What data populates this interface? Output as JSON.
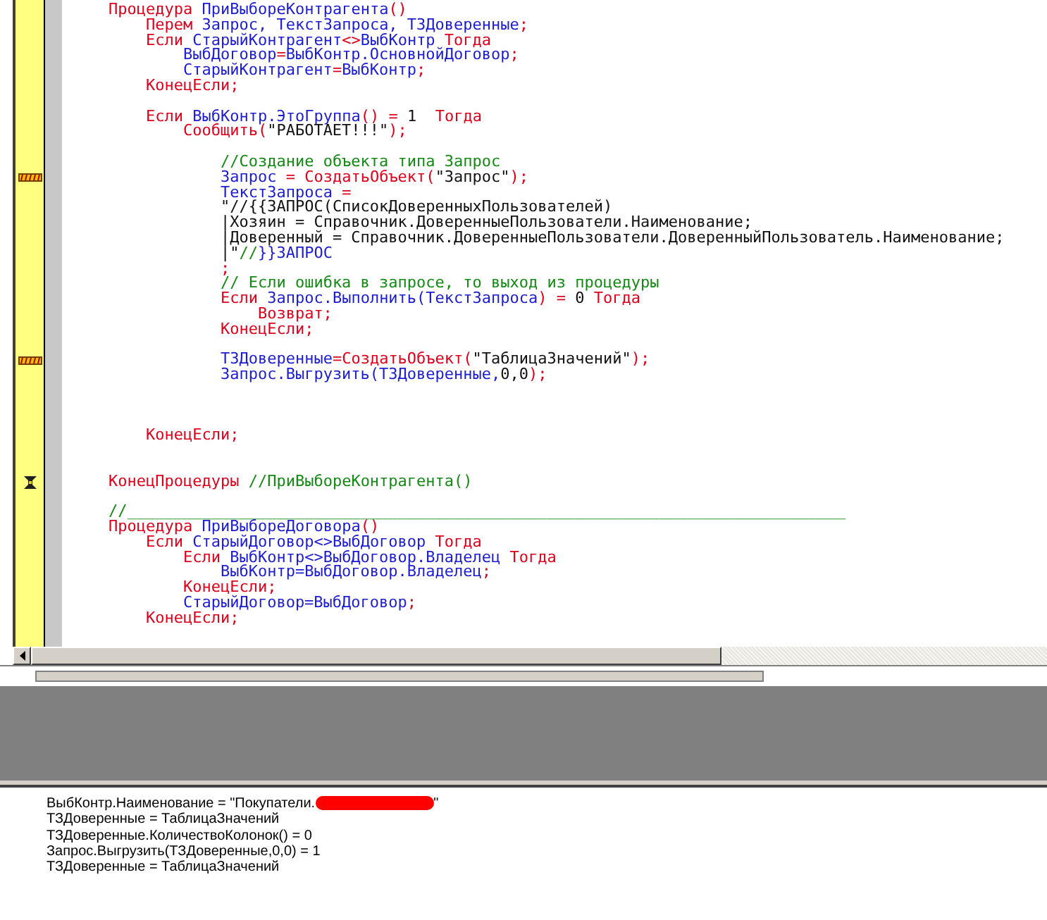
{
  "editor": {
    "lines": [
      {
        "kind": "code",
        "bookmarked": false,
        "current": false,
        "tokens": [
          {
            "kind": "kw",
            "text": "Процедура "
          },
          {
            "kind": "id",
            "text": "ПриВыбореКонтрагента"
          },
          {
            "kind": "kw",
            "text": "()"
          }
        ]
      },
      {
        "kind": "code",
        "bookmarked": false,
        "current": false,
        "tokens": [
          {
            "kind": "kw",
            "text": "    Перем "
          },
          {
            "kind": "id",
            "text": "Запрос, ТекстЗапроса, ТЗДоверенные"
          },
          {
            "kind": "kw",
            "text": ";"
          }
        ]
      },
      {
        "kind": "code",
        "bookmarked": false,
        "current": false,
        "tokens": [
          {
            "kind": "kw",
            "text": "    Если "
          },
          {
            "kind": "id",
            "text": "СтарыйКонтрагент"
          },
          {
            "kind": "kw",
            "text": "<>"
          },
          {
            "kind": "id",
            "text": "ВыбКонтр"
          },
          {
            "kind": "kw",
            "text": " Тогда"
          }
        ]
      },
      {
        "kind": "code",
        "bookmarked": false,
        "current": false,
        "tokens": [
          {
            "kind": "id",
            "text": "        ВыбДоговор"
          },
          {
            "kind": "kw",
            "text": "="
          },
          {
            "kind": "id",
            "text": "ВыбКонтр.ОсновнойДоговор"
          },
          {
            "kind": "kw",
            "text": ";"
          }
        ]
      },
      {
        "kind": "code",
        "bookmarked": false,
        "current": false,
        "tokens": [
          {
            "kind": "id",
            "text": "        СтарыйКонтрагент"
          },
          {
            "kind": "kw",
            "text": "="
          },
          {
            "kind": "id",
            "text": "ВыбКонтр"
          },
          {
            "kind": "kw",
            "text": ";"
          }
        ]
      },
      {
        "kind": "code",
        "bookmarked": false,
        "current": false,
        "tokens": [
          {
            "kind": "kw",
            "text": "    КонецЕсли;"
          }
        ]
      },
      {
        "kind": "blank",
        "bookmarked": false,
        "current": false
      },
      {
        "kind": "code",
        "bookmarked": false,
        "current": false,
        "tokens": [
          {
            "kind": "kw",
            "text": "    Если "
          },
          {
            "kind": "id",
            "text": "ВыбКонтр.ЭтоГруппа"
          },
          {
            "kind": "kw",
            "text": "() = "
          },
          {
            "kind": "tx",
            "text": "1"
          },
          {
            "kind": "kw",
            "text": "  Тогда"
          }
        ]
      },
      {
        "kind": "code",
        "bookmarked": false,
        "current": false,
        "tokens": [
          {
            "kind": "kw",
            "text": "        Сообщить("
          },
          {
            "kind": "tx",
            "text": "\"РАБОТАЕТ!!!\""
          },
          {
            "kind": "kw",
            "text": ");"
          }
        ]
      },
      {
        "kind": "blank",
        "bookmarked": false,
        "current": false
      },
      {
        "kind": "code",
        "bookmarked": false,
        "current": false,
        "tokens": [
          {
            "kind": "cm",
            "text": "            //Создание объекта типа Запрос"
          }
        ]
      },
      {
        "kind": "code",
        "bookmarked": true,
        "current": false,
        "tokens": [
          {
            "kind": "id",
            "text": "            Запрос"
          },
          {
            "kind": "kw",
            "text": " = СоздатьОбъект("
          },
          {
            "kind": "tx",
            "text": "\"Запрос\""
          },
          {
            "kind": "kw",
            "text": ");"
          }
        ]
      },
      {
        "kind": "code",
        "bookmarked": false,
        "current": false,
        "tokens": [
          {
            "kind": "id",
            "text": "            ТекстЗапроса"
          },
          {
            "kind": "kw",
            "text": " ="
          }
        ]
      },
      {
        "kind": "code",
        "bookmarked": false,
        "current": false,
        "tokens": [
          {
            "kind": "tx",
            "text": "            \"//{{ЗАПРОС(СписокДоверенныхПользователей)"
          }
        ]
      },
      {
        "kind": "code",
        "bookmarked": false,
        "current": false,
        "tokens": [
          {
            "kind": "tx",
            "text": "            |Хозяин = Справочник.ДоверенныеПользователи.Наименование;"
          }
        ]
      },
      {
        "kind": "code",
        "bookmarked": false,
        "current": false,
        "tokens": [
          {
            "kind": "tx",
            "text": "            |Доверенный = Справочник.ДоверенныеПользователи.ДоверенныйПользователь.Наименование;"
          }
        ]
      },
      {
        "kind": "code",
        "bookmarked": false,
        "current": false,
        "tokens": [
          {
            "kind": "tx",
            "text": "            |\""
          },
          {
            "kind": "cm",
            "text": "//"
          },
          {
            "kind": "id",
            "text": "}}ЗАПРОС"
          }
        ]
      },
      {
        "kind": "code",
        "bookmarked": false,
        "current": false,
        "tokens": [
          {
            "kind": "kw",
            "text": "            ;"
          }
        ]
      },
      {
        "kind": "code",
        "bookmarked": false,
        "current": false,
        "tokens": [
          {
            "kind": "cm",
            "text": "            // Если ошибка в запросе, то выход из процедуры"
          }
        ]
      },
      {
        "kind": "code",
        "bookmarked": false,
        "current": false,
        "tokens": [
          {
            "kind": "kw",
            "text": "            Если "
          },
          {
            "kind": "id",
            "text": "Запрос.Выполнить(ТекстЗапроса"
          },
          {
            "kind": "kw",
            "text": ") = "
          },
          {
            "kind": "tx",
            "text": "0"
          },
          {
            "kind": "kw",
            "text": " Тогда"
          }
        ]
      },
      {
        "kind": "code",
        "bookmarked": false,
        "current": false,
        "tokens": [
          {
            "kind": "kw",
            "text": "                Возврат;"
          }
        ]
      },
      {
        "kind": "code",
        "bookmarked": false,
        "current": false,
        "tokens": [
          {
            "kind": "kw",
            "text": "            КонецЕсли;"
          }
        ]
      },
      {
        "kind": "blank",
        "bookmarked": false,
        "current": false
      },
      {
        "kind": "code",
        "bookmarked": true,
        "current": false,
        "tokens": [
          {
            "kind": "id",
            "text": "            ТЗДоверенные"
          },
          {
            "kind": "kw",
            "text": "=СоздатьОбъект("
          },
          {
            "kind": "tx",
            "text": "\"ТаблицаЗначений\""
          },
          {
            "kind": "kw",
            "text": ");"
          }
        ]
      },
      {
        "kind": "code",
        "bookmarked": false,
        "current": false,
        "tokens": [
          {
            "kind": "id",
            "text": "            Запрос.Выгрузить(ТЗДоверенные,"
          },
          {
            "kind": "tx",
            "text": "0,0"
          },
          {
            "kind": "kw",
            "text": ");"
          }
        ]
      },
      {
        "kind": "blank",
        "bookmarked": false,
        "current": false
      },
      {
        "kind": "blank",
        "bookmarked": false,
        "current": false
      },
      {
        "kind": "blank",
        "bookmarked": false,
        "current": false
      },
      {
        "kind": "code",
        "bookmarked": false,
        "current": false,
        "tokens": [
          {
            "kind": "kw",
            "text": "    КонецЕсли;"
          }
        ]
      },
      {
        "kind": "blank",
        "bookmarked": false,
        "current": false
      },
      {
        "kind": "blank",
        "bookmarked": false,
        "current": false
      },
      {
        "kind": "code",
        "bookmarked": false,
        "current": true,
        "tokens": [
          {
            "kind": "kw",
            "text": "КонецПроцедуры "
          },
          {
            "kind": "cm",
            "text": "//ПриВыбореКонтрагента()"
          }
        ]
      },
      {
        "kind": "blank",
        "bookmarked": false,
        "current": false
      },
      {
        "kind": "code",
        "bookmarked": false,
        "current": false,
        "tokens": [
          {
            "kind": "cm",
            "text": "//_____________________________________________________________________________"
          }
        ]
      },
      {
        "kind": "code",
        "bookmarked": false,
        "current": false,
        "tokens": [
          {
            "kind": "kw",
            "text": "Процедура "
          },
          {
            "kind": "id",
            "text": "ПриВыбореДоговора"
          },
          {
            "kind": "kw",
            "text": "()"
          }
        ]
      },
      {
        "kind": "code",
        "bookmarked": false,
        "current": false,
        "tokens": [
          {
            "kind": "kw",
            "text": "    Если "
          },
          {
            "kind": "id",
            "text": "СтарыйДоговор<>ВыбДоговор"
          },
          {
            "kind": "kw",
            "text": " Тогда"
          }
        ]
      },
      {
        "kind": "code",
        "bookmarked": false,
        "current": false,
        "tokens": [
          {
            "kind": "kw",
            "text": "        Если "
          },
          {
            "kind": "id",
            "text": "ВыбКонтр<>ВыбДоговор.Владелец"
          },
          {
            "kind": "kw",
            "text": " Тогда"
          }
        ]
      },
      {
        "kind": "code",
        "bookmarked": false,
        "current": false,
        "tokens": [
          {
            "kind": "id",
            "text": "            ВыбКонтр=ВыбДоговор.Владелец"
          },
          {
            "kind": "kw",
            "text": ";"
          }
        ]
      },
      {
        "kind": "code",
        "bookmarked": false,
        "current": false,
        "tokens": [
          {
            "kind": "kw",
            "text": "        КонецЕсли;"
          }
        ]
      },
      {
        "kind": "code",
        "bookmarked": false,
        "current": false,
        "tokens": [
          {
            "kind": "id",
            "text": "        СтарыйДоговор=ВыбДоговор"
          },
          {
            "kind": "kw",
            "text": ";"
          }
        ]
      },
      {
        "kind": "code",
        "bookmarked": false,
        "current": false,
        "tokens": [
          {
            "kind": "kw",
            "text": "    КонецЕсли;"
          }
        ]
      }
    ]
  },
  "messages": [
    {
      "text": "ВыбКонтр.Наименование = \"Покупатели.",
      "redacted": true,
      "tail": "\""
    },
    {
      "text": "ТЗДоверенные = ТаблицаЗначений",
      "redacted": false
    },
    {
      "text": "ТЗДоверенные.КоличествоКолонок() = 0",
      "redacted": false
    },
    {
      "text": "Запрос.Выгрузить(ТЗДоверенные,0,0) = 1",
      "redacted": false
    },
    {
      "text": "ТЗДоверенные = ТаблицаЗначений",
      "redacted": false
    }
  ]
}
